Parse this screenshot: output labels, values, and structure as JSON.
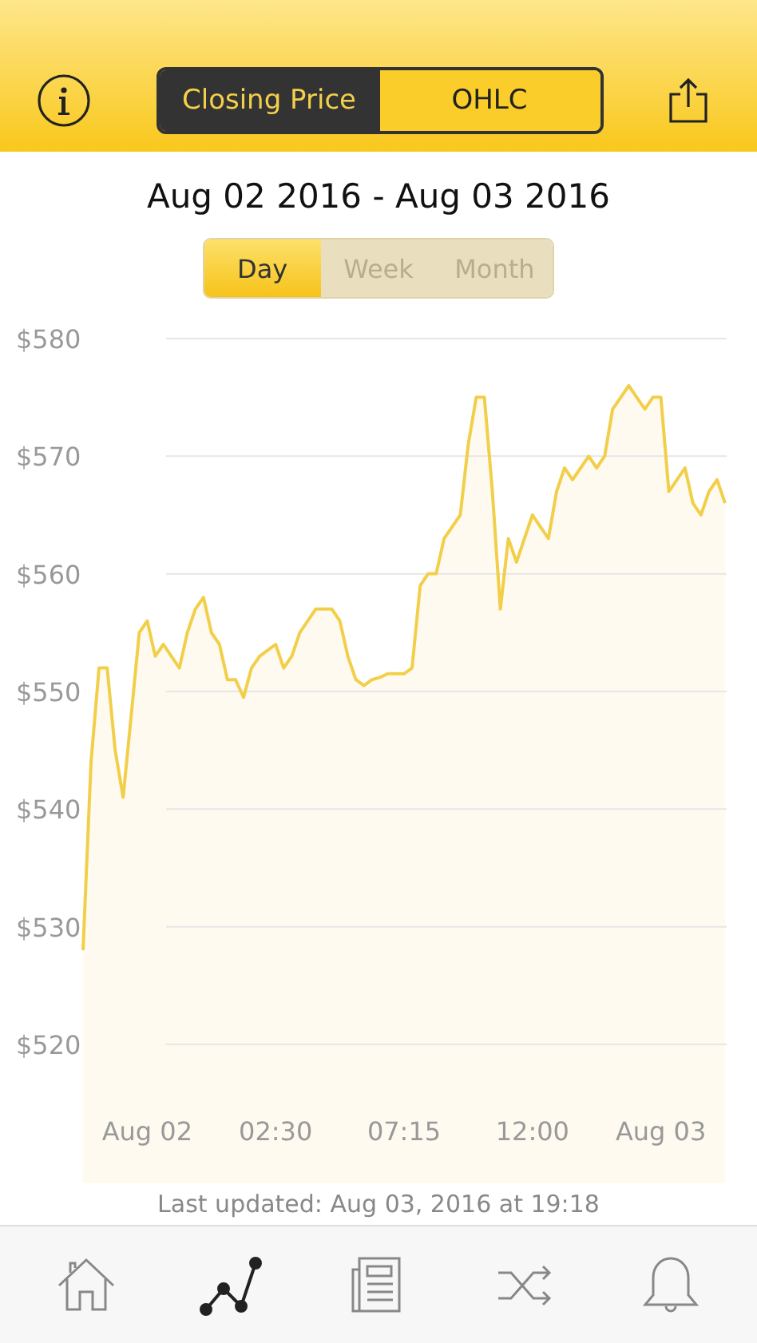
{
  "header": {
    "modes": [
      {
        "label": "Closing Price",
        "selected": true
      },
      {
        "label": "OHLC",
        "selected": false
      }
    ]
  },
  "date_range": "Aug 02 2016 - Aug 03 2016",
  "periods": [
    {
      "label": "Day",
      "selected": true
    },
    {
      "label": "Week",
      "selected": false
    },
    {
      "label": "Month",
      "selected": false
    }
  ],
  "chart_data": {
    "type": "area",
    "grid": true,
    "ylim": [
      520,
      580
    ],
    "yticks": [
      {
        "value": 520,
        "label": "$520"
      },
      {
        "value": 530,
        "label": "$530"
      },
      {
        "value": 540,
        "label": "$540"
      },
      {
        "value": 550,
        "label": "$550"
      },
      {
        "value": 560,
        "label": "$560"
      },
      {
        "value": 570,
        "label": "$570"
      },
      {
        "value": 580,
        "label": "$580"
      }
    ],
    "categories": [
      null,
      null,
      null,
      null,
      null,
      null,
      null,
      null,
      "Aug 02",
      null,
      null,
      null,
      null,
      null,
      null,
      null,
      null,
      null,
      null,
      null,
      null,
      null,
      null,
      null,
      "02:30",
      null,
      null,
      null,
      null,
      null,
      null,
      null,
      null,
      null,
      null,
      null,
      null,
      null,
      null,
      null,
      "07:15",
      null,
      null,
      null,
      null,
      null,
      null,
      null,
      null,
      null,
      null,
      null,
      null,
      null,
      null,
      null,
      "12:00",
      null,
      null,
      null,
      null,
      null,
      null,
      null,
      null,
      null,
      null,
      null,
      null,
      null,
      null,
      null,
      "Aug 03",
      null,
      null,
      null,
      null,
      null,
      null,
      null,
      null
    ],
    "series": [
      {
        "color": "#f2cf4a",
        "values": [
          528,
          544,
          552,
          552,
          545,
          541,
          548,
          555,
          556,
          553,
          554,
          553,
          552,
          555,
          557,
          558,
          555,
          554,
          551,
          551,
          549.5,
          552,
          553,
          553.5,
          554,
          552,
          553,
          555,
          556,
          557,
          557,
          557,
          556,
          553,
          551,
          550.5,
          551,
          551.2,
          551.5,
          551.5,
          551.5,
          552,
          559,
          560,
          560,
          563,
          564,
          565,
          571,
          575,
          575,
          567,
          557,
          563,
          561,
          563,
          565,
          564,
          563,
          567,
          569,
          568,
          569,
          570,
          569,
          570,
          574,
          575,
          576,
          575,
          574,
          575,
          575,
          567,
          568,
          569,
          566,
          565,
          567,
          568,
          566
        ]
      }
    ]
  },
  "last_updated": "Last updated: Aug 03, 2016 at 19:18",
  "tabs": [
    {
      "kind": "home",
      "selected": false
    },
    {
      "kind": "chart",
      "selected": true
    },
    {
      "kind": "news",
      "selected": false
    },
    {
      "kind": "shuffle",
      "selected": false
    },
    {
      "kind": "alert",
      "selected": false
    }
  ]
}
